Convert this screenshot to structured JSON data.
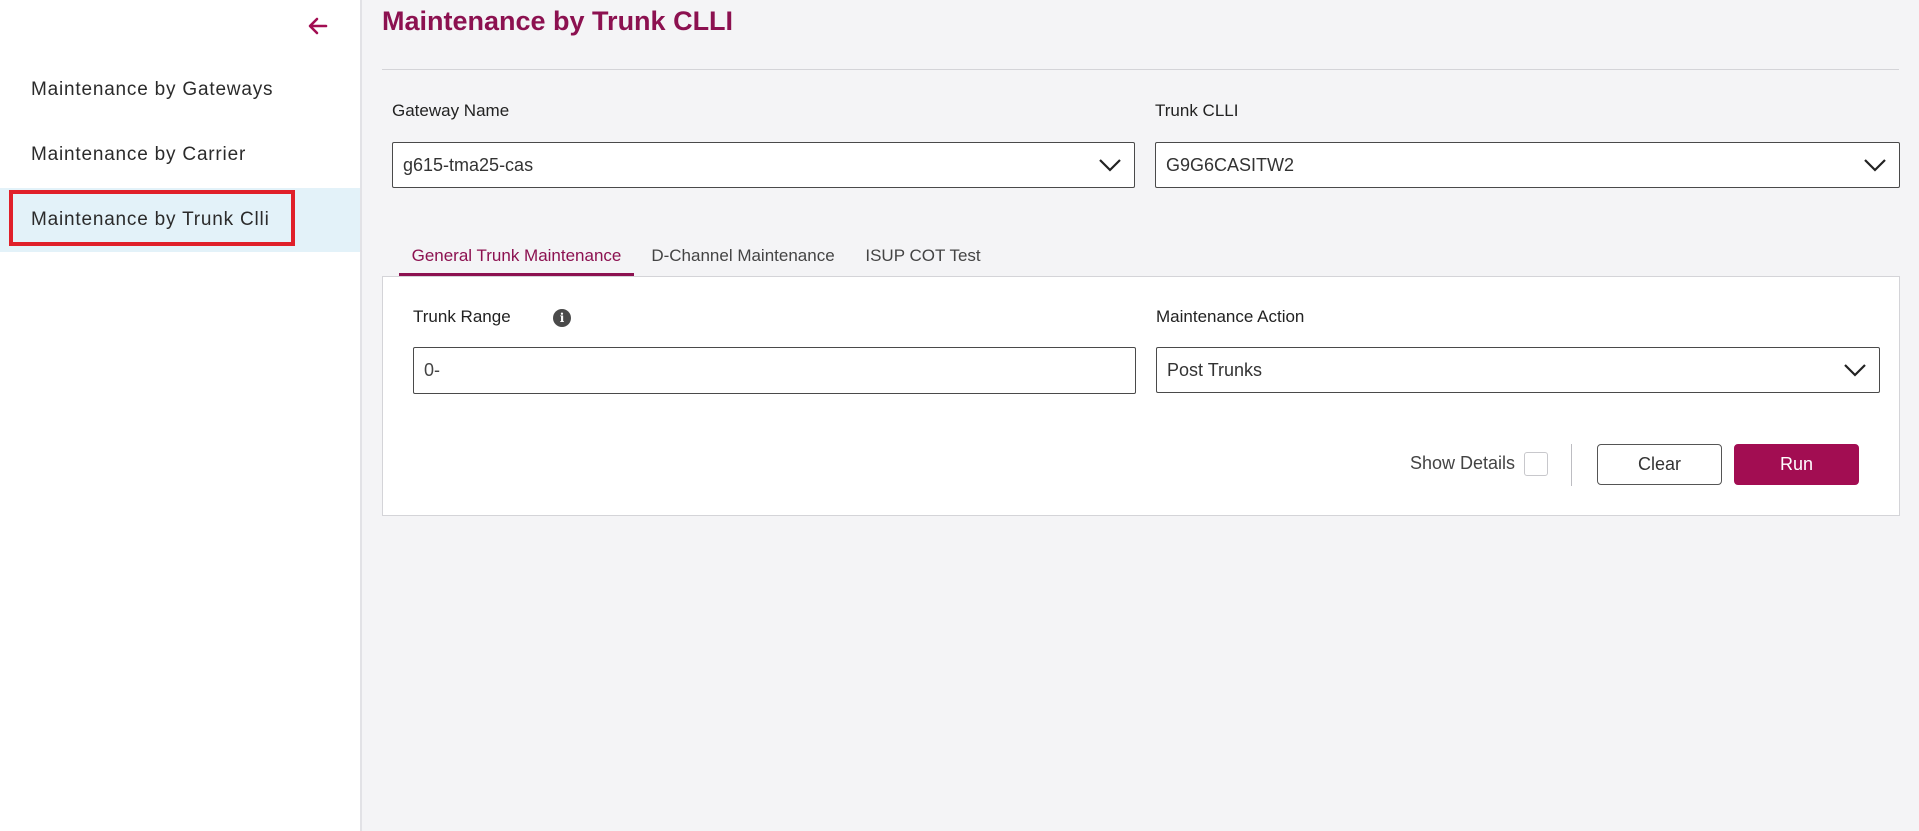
{
  "sidebar": {
    "items": [
      {
        "label": "Maintenance by Gateways"
      },
      {
        "label": "Maintenance by Carrier"
      },
      {
        "label": "Maintenance by Trunk Clli"
      }
    ]
  },
  "page": {
    "title": "Maintenance by Trunk CLLI"
  },
  "filters": {
    "gateway_label": "Gateway Name",
    "gateway_value": "g615-tma25-cas",
    "trunk_label": "Trunk CLLI",
    "trunk_value": "G9G6CASITW2"
  },
  "tabs": [
    {
      "label": "General Trunk Maintenance"
    },
    {
      "label": "D-Channel Maintenance"
    },
    {
      "label": "ISUP COT Test"
    }
  ],
  "form": {
    "trunk_range_label": "Trunk Range",
    "trunk_range_value": "0-",
    "action_label": "Maintenance Action",
    "action_value": "Post Trunks",
    "show_details_label": "Show Details",
    "show_details_checked": false,
    "clear_label": "Clear",
    "run_label": "Run"
  },
  "colors": {
    "brand": "#8c1150",
    "primary_button": "#a20d52",
    "active_nav_bg": "#e3f2f9",
    "highlight_border": "#e0202a"
  },
  "icons": {
    "back": "arrow-left-icon",
    "dropdown": "chevron-down-icon",
    "info": "info-icon"
  }
}
